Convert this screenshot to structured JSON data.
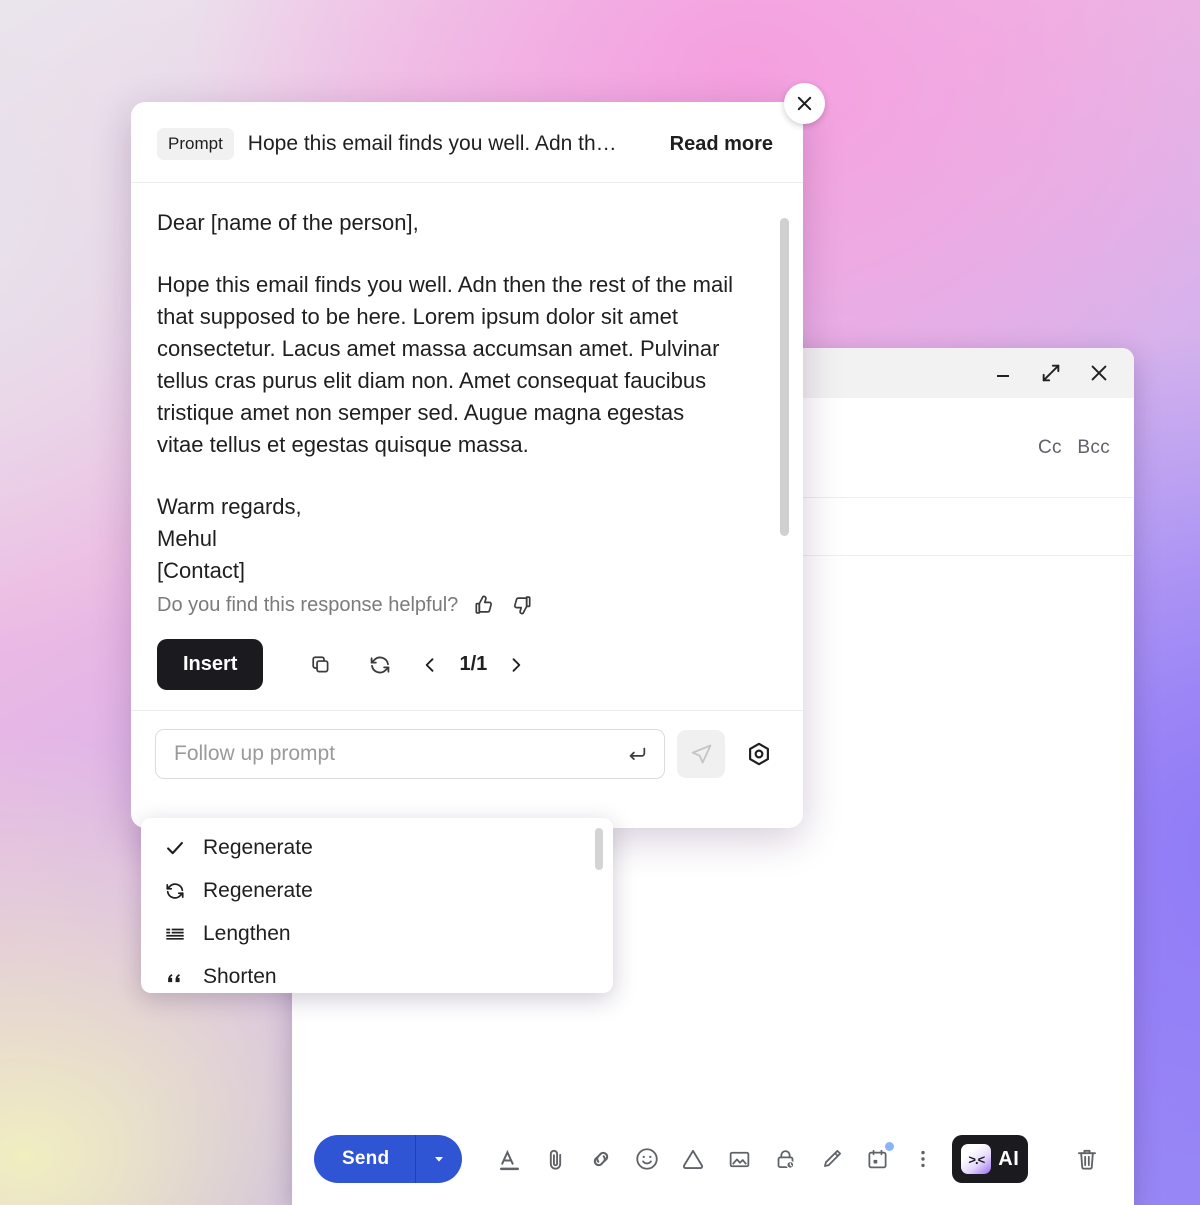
{
  "background": {
    "colors": [
      "#ece7ee",
      "#edb9e3",
      "#cdb0f0",
      "#a28cf6",
      "#f1eec0"
    ]
  },
  "compose_window": {
    "name": "gmail-compose",
    "window_controls": [
      {
        "name": "minimize",
        "glyph": "minimize-icon"
      },
      {
        "name": "expand",
        "glyph": "expand-icon"
      },
      {
        "name": "close",
        "glyph": "close-icon"
      }
    ],
    "cc_label": "Cc",
    "bcc_label": "Bcc",
    "toolbar": {
      "send_label": "Send",
      "send_color": "#2f55d4",
      "send_caret": "caret-down-icon",
      "icons": [
        "format-text-icon",
        "attach-file-icon",
        "insert-link-icon",
        "insert-emoji-icon",
        "insert-drive-icon",
        "insert-photo-icon",
        "confidential-mode-icon",
        "signature-icon",
        "schedule-send-icon",
        "more-options-icon"
      ],
      "ai_button": {
        "glyph_face": ">.<",
        "label": "AI"
      },
      "trash": "delete-draft-icon"
    }
  },
  "ai_panel": {
    "close_label": "×",
    "prompt": {
      "chip_label": "Prompt",
      "text": "Hope this email finds you well. Adn th…",
      "read_more_label": "Read more"
    },
    "response": {
      "salutation": "Dear [name of the person],",
      "paragraph": "Hope this email finds you well. Adn then the rest of the mail that supposed to be here. Lorem ipsum dolor sit amet consectetur. Lacus amet massa accumsan amet. Pulvinar tellus cras purus elit diam non. Amet consequat faucibus tristique amet non semper sed. Augue magna egestas vitae tellus et egestas quisque massa.",
      "signoff": "Warm regards,",
      "sender": "Mehul",
      "contact": "[Contact]"
    },
    "feedback": {
      "question": "Do you find this response helpful?",
      "thumbs_up": "thumbs-up-icon",
      "thumbs_down": "thumbs-down-icon"
    },
    "actions": {
      "insert_label": "Insert",
      "copy_icon": "copy-icon",
      "regenerate_icon": "refresh-icon",
      "prev_icon": "chevron-left-icon",
      "page_count": "1/1",
      "next_icon": "chevron-right-icon"
    },
    "followup": {
      "placeholder": "Follow up prompt",
      "value": "",
      "enter_icon": "enter-return-icon",
      "send_icon": "send-paper-plane-icon",
      "settings_icon": "settings-target-icon"
    }
  },
  "dropdown": {
    "items": [
      {
        "label": "Regenerate",
        "icon": "check-icon",
        "selected": true
      },
      {
        "label": "Regenerate",
        "icon": "refresh-icon",
        "selected": false
      },
      {
        "label": "Lengthen",
        "icon": "lengthen-icon",
        "selected": false
      },
      {
        "label": "Shorten",
        "icon": "shorten-quote-icon",
        "selected": false
      }
    ]
  }
}
